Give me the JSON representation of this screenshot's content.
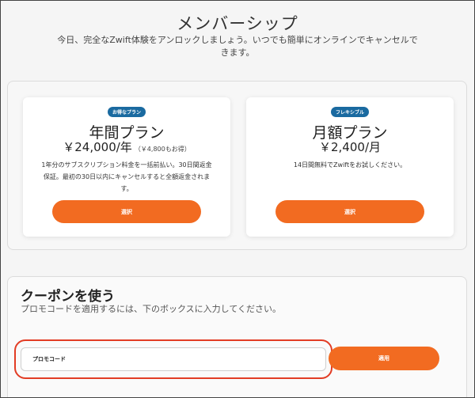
{
  "header": {
    "title": "メンバーシップ",
    "subtitle": "今日、完全なZwift体験をアンロックしましょう。いつでも簡単にオンラインでキャンセルできます。"
  },
  "plans": [
    {
      "badge": "お得なプラン",
      "name": "年間プラン",
      "price": "￥24,000/年",
      "savings": "（￥4,800もお得）",
      "description": "1年分のサブスクリプション料金を一括前払い。30日間返金保証。最初の30日以内にキャンセルすると全額返金されます。",
      "button_label": "選択"
    },
    {
      "badge": "フレキシブル",
      "name": "月額プラン",
      "price": "￥2,400/月",
      "savings": "",
      "description": "14日間無料でZwiftをお試しください。",
      "button_label": "選択"
    }
  ],
  "coupon": {
    "title": "クーポンを使う",
    "description": "プロモコードを適用するには、下のボックスに入力してください。",
    "input_placeholder": "プロモコード",
    "apply_label": "適用"
  },
  "colors": {
    "accent": "#f26b21",
    "badge": "#1a6aa0",
    "highlight": "#e23c24"
  }
}
